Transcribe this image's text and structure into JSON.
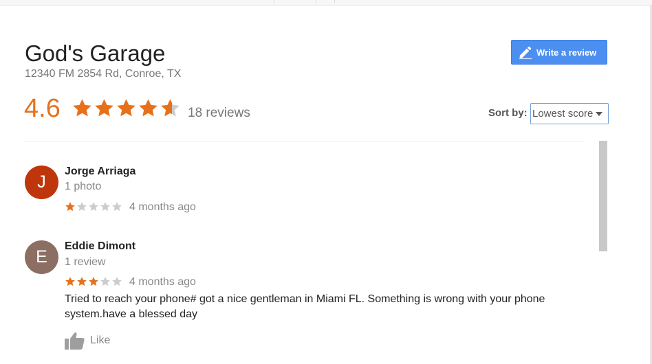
{
  "business": {
    "name": "God's Garage",
    "address": "12340 FM 2854 Rd, Conroe, TX"
  },
  "actions": {
    "write_review_label": "Write a review"
  },
  "summary": {
    "rating_text": "4.6",
    "rating": 4.6,
    "review_count_text": "18 reviews"
  },
  "sort": {
    "label": "Sort by:",
    "selected": "Lowest score"
  },
  "colors": {
    "star_filled": "#e7711b",
    "star_empty": "#cccccc",
    "accent_button": "#4d8ff0"
  },
  "reviews": [
    {
      "initial": "J",
      "avatar_color": "#bf360c",
      "name": "Jorge Arriaga",
      "meta": "1 photo",
      "rating": 1,
      "time": "4 months ago",
      "text": ""
    },
    {
      "initial": "E",
      "avatar_color": "#8d6e63",
      "name": "Eddie Dimont",
      "meta": "1 review",
      "rating": 3,
      "time": "4 months ago",
      "text": "Tried to reach your phone# got a nice gentleman in Miami FL. Something is wrong with your phone system.have a blessed day",
      "like_label": "Like"
    }
  ]
}
